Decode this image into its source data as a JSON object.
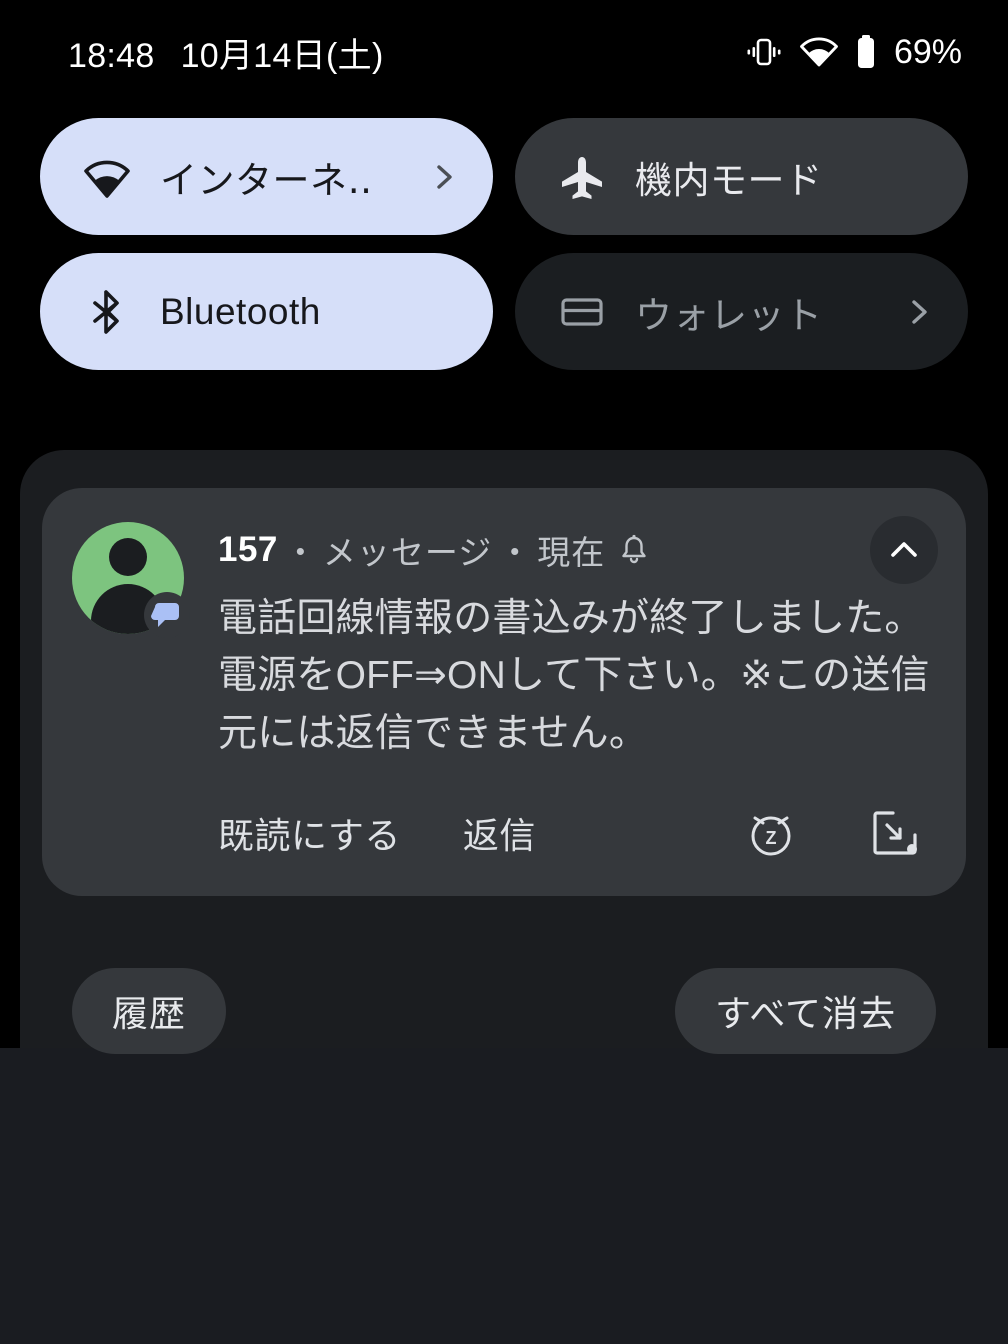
{
  "status_bar": {
    "time": "18:48",
    "date": "10月14日(土)",
    "battery_percent": "69%",
    "icons": [
      "vibrate-icon",
      "wifi-icon",
      "battery-icon"
    ]
  },
  "quick_settings": {
    "tiles": [
      {
        "label": "インターネ‥",
        "icon": "wifi-icon",
        "state": "on",
        "chevron": true
      },
      {
        "label": "機内モード",
        "icon": "airplane-icon",
        "state": "off",
        "chevron": false
      },
      {
        "label": "Bluetooth",
        "icon": "bluetooth-icon",
        "state": "on",
        "chevron": false
      },
      {
        "label": "ウォレット",
        "icon": "wallet-icon",
        "state": "dim",
        "chevron": true
      }
    ]
  },
  "notification": {
    "app_name": "157",
    "separator": "・",
    "category": "メッセージ",
    "time": "現在",
    "alert_icon": "bell-icon",
    "avatar_icon": "person-avatar",
    "badge_icon": "message-bubble-icon",
    "body": "電話回線情報の書込みが終了しました。電源をOFF⇒ONして下さい。※この送信元には返信できません。",
    "collapse_icon": "chevron-up-icon",
    "actions": {
      "mark_read": "既読にする",
      "reply": "返信",
      "snooze_icon": "snooze-alarm-icon",
      "bubble_icon": "open-in-bubble-icon"
    }
  },
  "footer": {
    "history_label": "履歴",
    "clear_all_label": "すべて消去"
  },
  "colors": {
    "background": "#000000",
    "shade": "#1b1d20",
    "tile_active": "#d6dff9",
    "tile_inactive": "#35383c",
    "tile_disabled": "#1b1e21",
    "card": "#35383c",
    "avatar_green": "#7dc47f",
    "badge_blue": "#aac0f5",
    "text_primary": "#ffffff",
    "text_secondary": "#c2c6cb"
  }
}
